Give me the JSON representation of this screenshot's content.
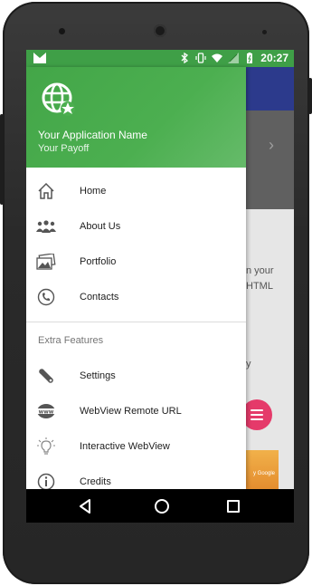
{
  "status_bar": {
    "time": "20:27",
    "icons": [
      "app-notification-icon",
      "bluetooth-icon",
      "vibrate-icon",
      "wifi-icon",
      "signal-icon",
      "battery-icon"
    ]
  },
  "drawer": {
    "header": {
      "app_name": "Your Application Name",
      "payoff": "Your Payoff",
      "logo_icon": "globe-star-icon"
    },
    "items": [
      {
        "label": "Home",
        "icon": "home-icon"
      },
      {
        "label": "About Us",
        "icon": "people-icon"
      },
      {
        "label": "Portfolio",
        "icon": "image-stack-icon"
      },
      {
        "label": "Contacts",
        "icon": "phone-icon"
      }
    ],
    "section_title": "Extra Features",
    "extra_items": [
      {
        "label": "Settings",
        "icon": "wrench-icon"
      },
      {
        "label": "WebView Remote URL",
        "icon": "www-icon"
      },
      {
        "label": "Interactive WebView",
        "icon": "lightbulb-icon"
      },
      {
        "label": "Credits",
        "icon": "info-icon"
      }
    ]
  },
  "background": {
    "text_line_1": "n your",
    "text_line_2": "HTML",
    "text_line_3": "y",
    "ad_text": "y Google"
  },
  "colors": {
    "header_green": "#4caf50",
    "toolbar_blue": "#2c3a8c",
    "fab_pink": "#e53a6a"
  }
}
